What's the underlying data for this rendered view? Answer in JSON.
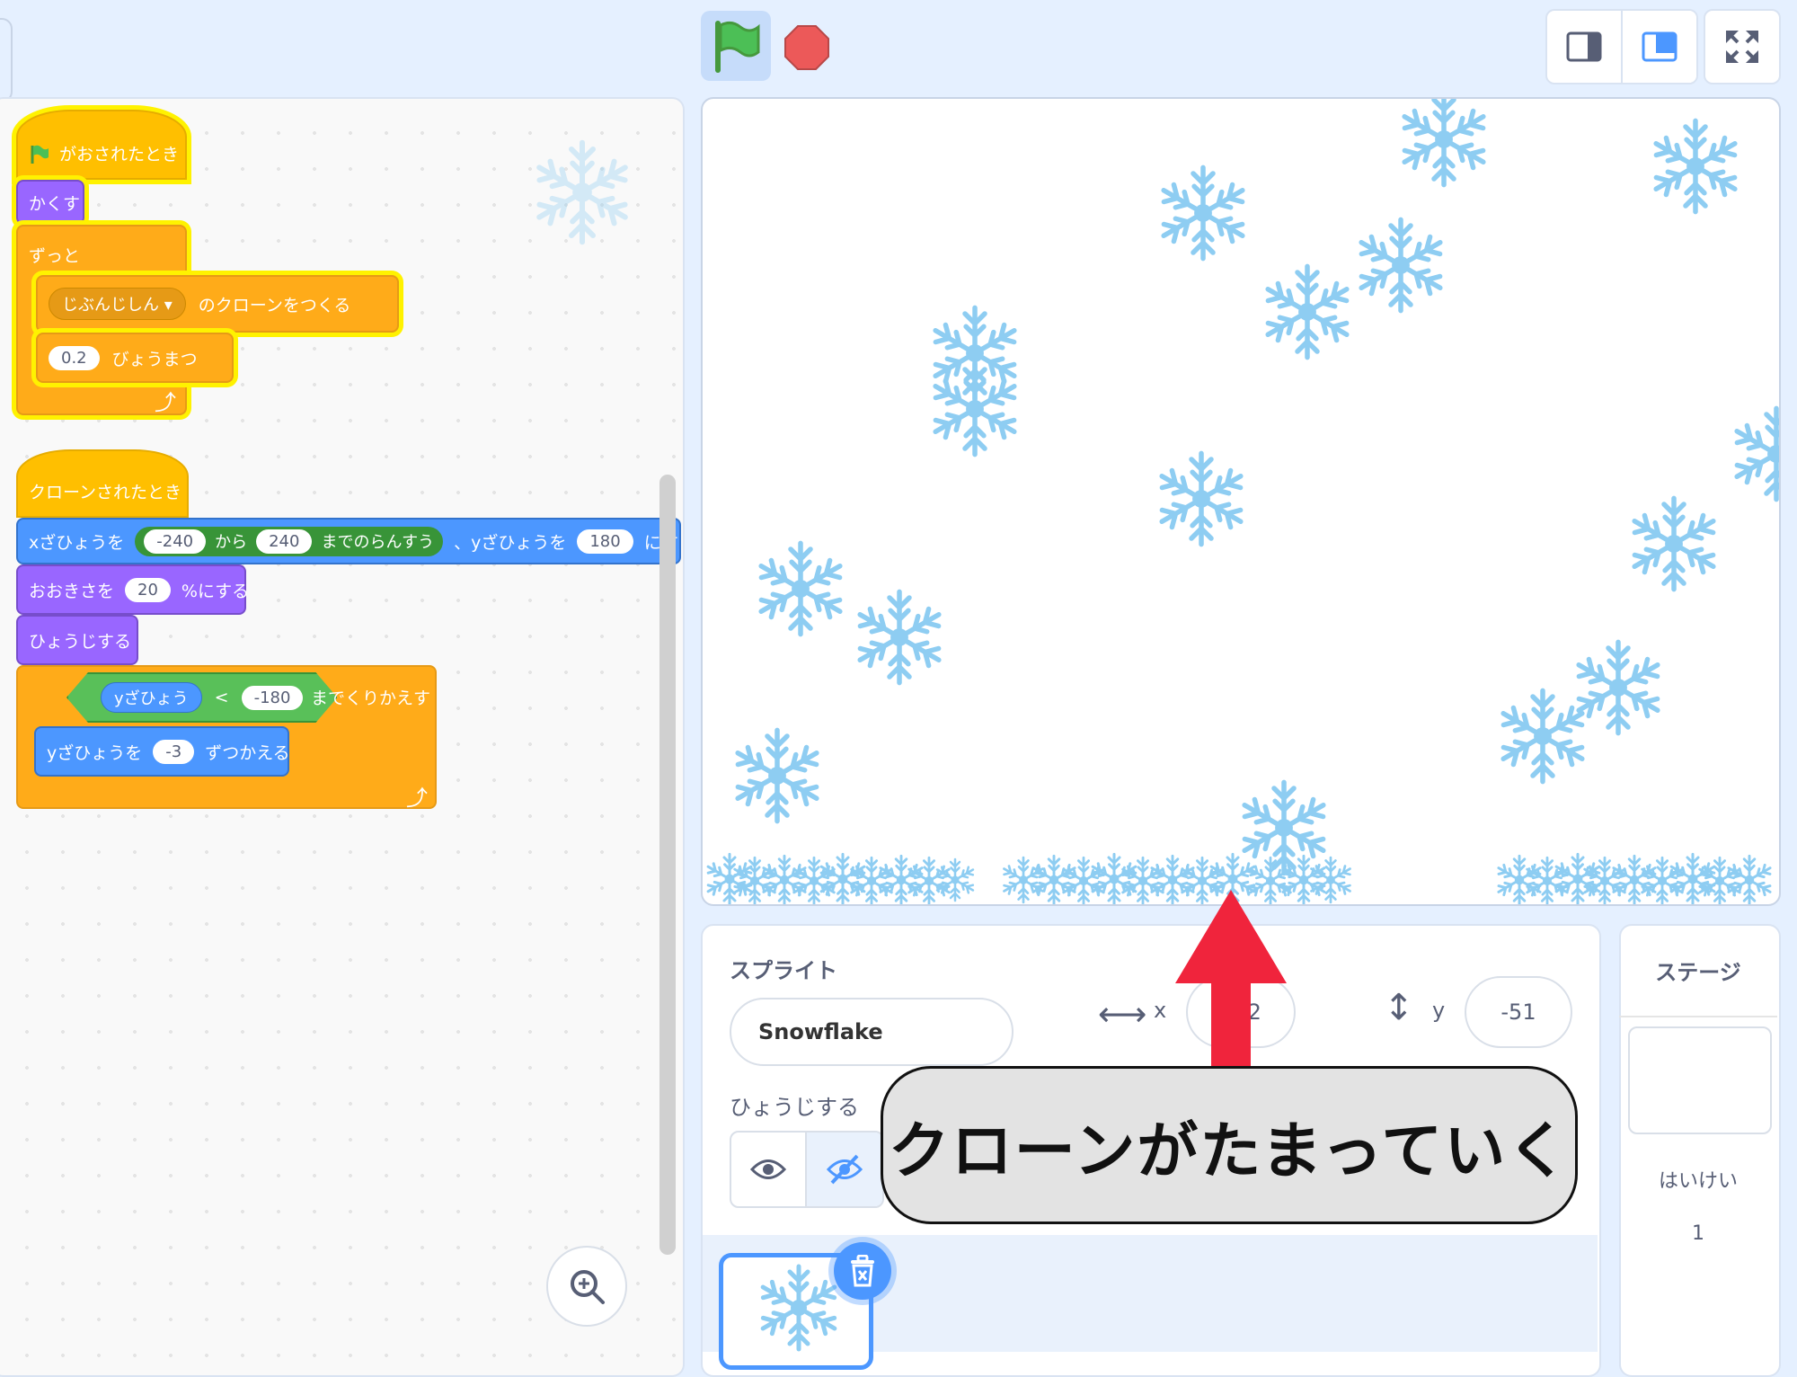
{
  "toolbar": {
    "green_flag": "green-flag",
    "stop": "stop-sign"
  },
  "code": {
    "script1": {
      "hat": "がおされたとき",
      "hide": "かくす",
      "forever": "ずっと",
      "clone_target": "じぶんじしん",
      "clone_label": "のクローンをつくる",
      "wait_value": "0.2",
      "wait_label": "びょうまつ"
    },
    "script2": {
      "hat": "クローンされたとき",
      "goto_x_label": "xざひょうを",
      "rand_from": "-240",
      "rand_mid": "から",
      "rand_to": "240",
      "rand_label": "までのらんすう",
      "goto_y_label": "、yざひょうを",
      "y_value": "180",
      "goto_tail": "にす",
      "size_label": "おおきさを",
      "size_value": "20",
      "size_tail": "%にする",
      "show": "ひょうじする",
      "repeat_y": "yざひょう",
      "repeat_op": "<",
      "repeat_value": "-180",
      "repeat_label": "までくりかえす",
      "change_label": "yざひょうを",
      "change_value": "-3",
      "change_tail": "ずつかえる"
    }
  },
  "sprite_info": {
    "title": "スプライト",
    "name": "Snowflake",
    "x_label": "x",
    "x_value": "212",
    "y_label": "y",
    "y_value": "-51",
    "show_label": "ひょうじする"
  },
  "stage_panel": {
    "title": "ステージ",
    "backdrops_label": "はいけい",
    "backdrops_count": "1"
  },
  "annotation": {
    "text": "クローンがたまっていく",
    "arrow_color": "#f0243c"
  },
  "colors": {
    "snowflake": "#8ecdf2",
    "accent": "#4c97ff"
  }
}
